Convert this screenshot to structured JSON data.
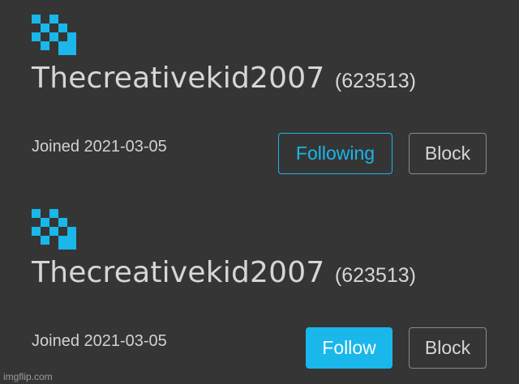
{
  "cards": [
    {
      "username": "Thecreativekid2007",
      "user_id": "(623513)",
      "joined": "Joined 2021-03-05",
      "follow_label": "Following",
      "block_label": "Block"
    },
    {
      "username": "Thecreativekid2007",
      "user_id": "(623513)",
      "joined": "Joined 2021-03-05",
      "follow_label": "Follow",
      "block_label": "Block"
    }
  ],
  "watermark": "imgflip.com",
  "colors": {
    "background": "#353535",
    "accent": "#19b7ea",
    "text": "#d6d6d6",
    "block_border": "#8a8a8a"
  }
}
